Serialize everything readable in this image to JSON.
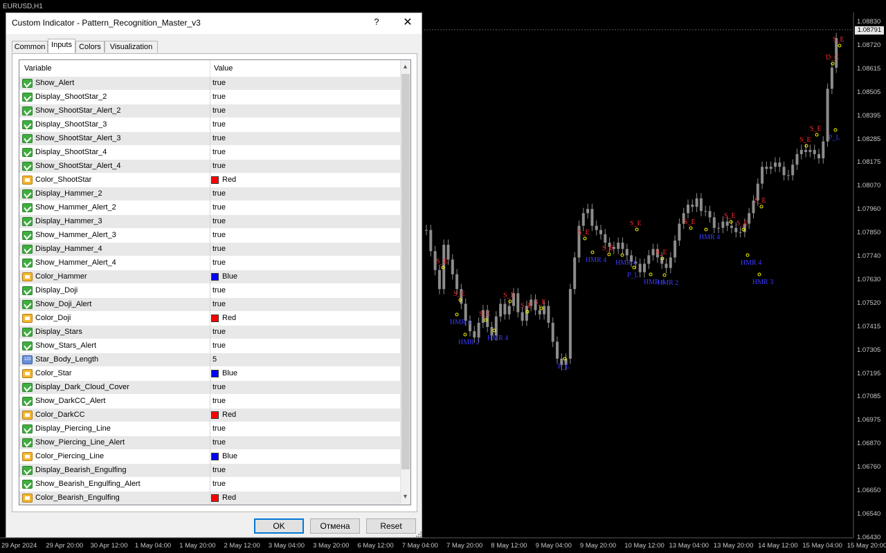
{
  "chart": {
    "symbol": "EURUSD,H1",
    "current_price": "1.08791",
    "price_axis": [
      "1.08830",
      "1.08720",
      "1.08615",
      "1.08505",
      "1.08395",
      "1.08285",
      "1.08175",
      "1.08070",
      "1.07960",
      "1.07850",
      "1.07740",
      "1.07630",
      "1.07520",
      "1.07415",
      "1.07305",
      "1.07195",
      "1.07085",
      "1.06975",
      "1.06870",
      "1.06760",
      "1.06650",
      "1.06540",
      "1.06430"
    ],
    "time_axis": [
      "29 Apr 2024",
      "29 Apr 20:00",
      "30 Apr 12:00",
      "1 May 04:00",
      "1 May 20:00",
      "2 May 12:00",
      "3 May 04:00",
      "3 May 20:00",
      "6 May 12:00",
      "7 May 04:00",
      "7 May 20:00",
      "8 May 12:00",
      "9 May 04:00",
      "9 May 20:00",
      "10 May 12:00",
      "13 May 04:00",
      "13 May 20:00",
      "14 May 12:00",
      "15 May 04:00",
      "15 May 20:00"
    ],
    "colors": {
      "background": "#000000",
      "candle": "#8c8c8c",
      "bearish_label": "#ff2a2a",
      "bullish_label": "#3a3aff",
      "arrow": "#ffff00"
    },
    "price_range": [
      1.0643,
      1.0883
    ],
    "candles": [
      1.0788,
      1.0778,
      1.0769,
      1.076,
      1.0781,
      1.0774,
      1.0767,
      1.076,
      1.0753,
      1.0745,
      1.074,
      1.0737,
      1.0744,
      1.075,
      1.0742,
      1.0738,
      1.0747,
      1.0753,
      1.0748,
      1.0752,
      1.0758,
      1.0749,
      1.0745,
      1.0752,
      1.0755,
      1.075,
      1.0748,
      1.0752,
      1.0744,
      1.0735,
      1.0727,
      1.0724,
      1.0727,
      1.076,
      1.0775,
      1.079,
      1.0796,
      1.0798,
      1.079,
      1.0788,
      1.0786,
      1.0782,
      1.078,
      1.0779,
      1.0782,
      1.0779,
      1.0776,
      1.0773,
      1.0772,
      1.0768,
      1.0772,
      1.0776,
      1.0779,
      1.0775,
      1.0772,
      1.077,
      1.0775,
      1.0783,
      1.0791,
      1.0796,
      1.08,
      1.0799,
      1.0803,
      1.0797,
      1.0797,
      1.0794,
      1.0789,
      1.0789,
      1.0792,
      1.079,
      1.0789,
      1.0787,
      1.0787,
      1.0791,
      1.0796,
      1.0802,
      1.081,
      1.0818,
      1.0817,
      1.0818,
      1.082,
      1.0818,
      1.0814,
      1.0814,
      1.0819,
      1.0824,
      1.0826,
      1.0825,
      1.0826,
      1.0824,
      1.0822,
      1.083,
      1.0855,
      1.0865,
      1.0879
    ],
    "markers": [
      {
        "label": "S_E",
        "type": "bearish"
      },
      {
        "label": "S_E",
        "type": "bearish"
      },
      {
        "label": "S_E",
        "type": "bearish"
      },
      {
        "label": "S_E",
        "type": "bearish"
      },
      {
        "label": "S_E",
        "type": "bearish"
      },
      {
        "label": "S_E",
        "type": "bearish"
      },
      {
        "label": "S_E",
        "type": "bearish"
      },
      {
        "label": "S_E",
        "type": "bearish"
      },
      {
        "label": "S_E",
        "type": "bearish"
      },
      {
        "label": "S_E",
        "type": "bearish"
      },
      {
        "label": "S_E",
        "type": "bearish"
      },
      {
        "label": "S_E",
        "type": "bearish"
      },
      {
        "label": "S_E",
        "type": "bearish"
      },
      {
        "label": "S_E",
        "type": "bearish"
      },
      {
        "label": "S_E",
        "type": "bearish"
      },
      {
        "label": "S_E",
        "type": "bearish"
      },
      {
        "label": "D_C",
        "type": "bearish"
      },
      {
        "label": "S_E",
        "type": "bearish"
      },
      {
        "label": "HMR 4",
        "type": "bullish"
      },
      {
        "label": "HMR 2",
        "type": "bullish"
      },
      {
        "label": "HMR 4",
        "type": "bullish"
      },
      {
        "label": "P_L",
        "type": "bullish"
      },
      {
        "label": "HMR 4",
        "type": "bullish"
      },
      {
        "label": "HMR 4",
        "type": "bullish"
      },
      {
        "label": "P_L",
        "type": "bullish"
      },
      {
        "label": "HMR 4",
        "type": "bullish"
      },
      {
        "label": "HMR 2",
        "type": "bullish"
      },
      {
        "label": "HMR 4",
        "type": "bullish"
      },
      {
        "label": "HMR 4",
        "type": "bullish"
      },
      {
        "label": "HMR 3",
        "type": "bullish"
      },
      {
        "label": "P_L",
        "type": "bullish"
      }
    ]
  },
  "dialog": {
    "title": "Custom Indicator - Pattern_Recognition_Master_v3",
    "help": "?",
    "close": "✕",
    "tabs": [
      {
        "label": "Common",
        "active": false
      },
      {
        "label": "Inputs",
        "active": true
      },
      {
        "label": "Colors",
        "active": false
      },
      {
        "label": "Visualization",
        "active": false
      }
    ],
    "columns": {
      "variable": "Variable",
      "value": "Value"
    },
    "rows": [
      {
        "name": "Show_Alert",
        "value": "true",
        "kind": "bool"
      },
      {
        "name": "Display_ShootStar_2",
        "value": "true",
        "kind": "bool"
      },
      {
        "name": "Show_ShootStar_Alert_2",
        "value": "true",
        "kind": "bool"
      },
      {
        "name": "Display_ShootStar_3",
        "value": "true",
        "kind": "bool"
      },
      {
        "name": "Show_ShootStar_Alert_3",
        "value": "true",
        "kind": "bool"
      },
      {
        "name": "Display_ShootStar_4",
        "value": "true",
        "kind": "bool"
      },
      {
        "name": "Show_ShootStar_Alert_4",
        "value": "true",
        "kind": "bool"
      },
      {
        "name": "Color_ShootStar",
        "value": "Red",
        "kind": "color",
        "swatch": "#ff0000"
      },
      {
        "name": "Display_Hammer_2",
        "value": "true",
        "kind": "bool"
      },
      {
        "name": "Show_Hammer_Alert_2",
        "value": "true",
        "kind": "bool"
      },
      {
        "name": "Display_Hammer_3",
        "value": "true",
        "kind": "bool"
      },
      {
        "name": "Show_Hammer_Alert_3",
        "value": "true",
        "kind": "bool"
      },
      {
        "name": "Display_Hammer_4",
        "value": "true",
        "kind": "bool"
      },
      {
        "name": "Show_Hammer_Alert_4",
        "value": "true",
        "kind": "bool"
      },
      {
        "name": "Color_Hammer",
        "value": "Blue",
        "kind": "color",
        "swatch": "#0000ff"
      },
      {
        "name": "Display_Doji",
        "value": "true",
        "kind": "bool"
      },
      {
        "name": "Show_Doji_Alert",
        "value": "true",
        "kind": "bool"
      },
      {
        "name": "Color_Doji",
        "value": "Red",
        "kind": "color",
        "swatch": "#ff0000"
      },
      {
        "name": "Display_Stars",
        "value": "true",
        "kind": "bool"
      },
      {
        "name": "Show_Stars_Alert",
        "value": "true",
        "kind": "bool"
      },
      {
        "name": "Star_Body_Length",
        "value": "5",
        "kind": "num"
      },
      {
        "name": "Color_Star",
        "value": "Blue",
        "kind": "color",
        "swatch": "#0000ff"
      },
      {
        "name": "Display_Dark_Cloud_Cover",
        "value": "true",
        "kind": "bool"
      },
      {
        "name": "Show_DarkCC_Alert",
        "value": "true",
        "kind": "bool"
      },
      {
        "name": "Color_DarkCC",
        "value": "Red",
        "kind": "color",
        "swatch": "#ff0000"
      },
      {
        "name": "Display_Piercing_Line",
        "value": "true",
        "kind": "bool"
      },
      {
        "name": "Show_Piercing_Line_Alert",
        "value": "true",
        "kind": "bool"
      },
      {
        "name": "Color_Piercing_Line",
        "value": "Blue",
        "kind": "color",
        "swatch": "#0000ff"
      },
      {
        "name": "Display_Bearish_Engulfing",
        "value": "true",
        "kind": "bool"
      },
      {
        "name": "Show_Bearish_Engulfing_Alert",
        "value": "true",
        "kind": "bool"
      },
      {
        "name": "Color_Bearish_Engulfing",
        "value": "Red",
        "kind": "color",
        "swatch": "#ff0000"
      }
    ],
    "buttons": {
      "ok": "OK",
      "cancel": "Отмена",
      "reset": "Reset"
    },
    "num_icon": "123",
    "scroll_up": "▲",
    "scroll_down": "▼"
  }
}
